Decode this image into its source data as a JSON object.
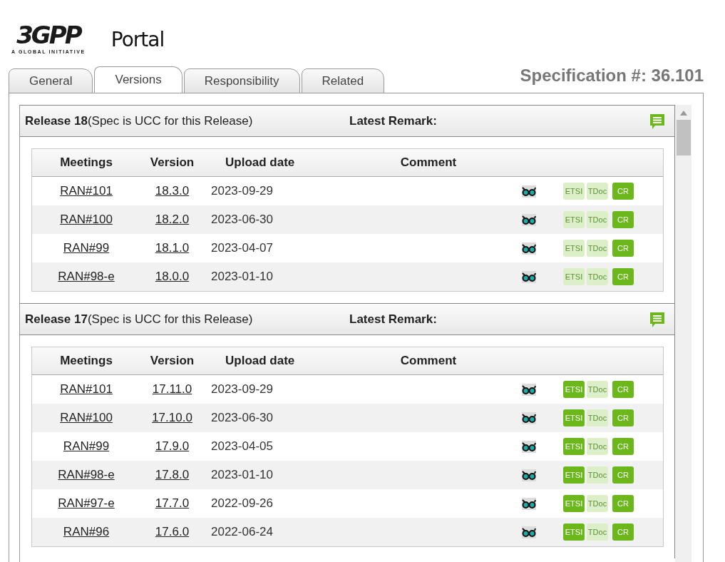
{
  "logo": {
    "mark": "3GPP",
    "tagline": "A GLOBAL INITIATIVE",
    "portal": "Portal"
  },
  "tabs": [
    {
      "label": "General",
      "selected": false
    },
    {
      "label": "Versions",
      "selected": true
    },
    {
      "label": "Responsibility",
      "selected": false
    },
    {
      "label": "Related",
      "selected": false
    }
  ],
  "spec_title": "Specification #: 36.101",
  "releases": [
    {
      "title": "**Release 18**(Spec is UCC for this Release)",
      "remark_label": "Latest Remark:",
      "columns": [
        "Meetings",
        "Version",
        "Upload date",
        "Comment"
      ],
      "rows": [
        {
          "meeting": "RAN#101",
          "version": "18.3.0",
          "date": "2023-09-29",
          "links": [
            {
              "label": "ETSI",
              "enabled": false
            },
            {
              "label": "TDoc",
              "enabled": false
            },
            {
              "label": "CR",
              "enabled": true
            }
          ]
        },
        {
          "meeting": "RAN#100",
          "version": "18.2.0",
          "date": "2023-06-30",
          "links": [
            {
              "label": "ETSI",
              "enabled": false
            },
            {
              "label": "TDoc",
              "enabled": false
            },
            {
              "label": "CR",
              "enabled": true
            }
          ]
        },
        {
          "meeting": "RAN#99",
          "version": "18.1.0",
          "date": "2023-04-07",
          "links": [
            {
              "label": "ETSI",
              "enabled": false
            },
            {
              "label": "TDoc",
              "enabled": false
            },
            {
              "label": "CR",
              "enabled": true
            }
          ]
        },
        {
          "meeting": "RAN#98-e",
          "version": "18.0.0",
          "date": "2023-01-10",
          "links": [
            {
              "label": "ETSI",
              "enabled": false
            },
            {
              "label": "TDoc",
              "enabled": false
            },
            {
              "label": "CR",
              "enabled": true
            }
          ]
        }
      ]
    },
    {
      "title": "**Release 17**(Spec is UCC for this Release)",
      "remark_label": "Latest Remark:",
      "columns": [
        "Meetings",
        "Version",
        "Upload date",
        "Comment"
      ],
      "rows": [
        {
          "meeting": "RAN#101",
          "version": "17.11.0",
          "date": "2023-09-29",
          "links": [
            {
              "label": "ETSI",
              "enabled": true
            },
            {
              "label": "TDoc",
              "enabled": false
            },
            {
              "label": "CR",
              "enabled": true
            }
          ]
        },
        {
          "meeting": "RAN#100",
          "version": "17.10.0",
          "date": "2023-06-30",
          "links": [
            {
              "label": "ETSI",
              "enabled": true
            },
            {
              "label": "TDoc",
              "enabled": false
            },
            {
              "label": "CR",
              "enabled": true
            }
          ]
        },
        {
          "meeting": "RAN#99",
          "version": "17.9.0",
          "date": "2023-04-05",
          "links": [
            {
              "label": "ETSI",
              "enabled": true
            },
            {
              "label": "TDoc",
              "enabled": false
            },
            {
              "label": "CR",
              "enabled": true
            }
          ]
        },
        {
          "meeting": "RAN#98-e",
          "version": "17.8.0",
          "date": "2023-01-10",
          "links": [
            {
              "label": "ETSI",
              "enabled": true
            },
            {
              "label": "TDoc",
              "enabled": false
            },
            {
              "label": "CR",
              "enabled": true
            }
          ]
        },
        {
          "meeting": "RAN#97-e",
          "version": "17.7.0",
          "date": "2022-09-26",
          "links": [
            {
              "label": "ETSI",
              "enabled": true
            },
            {
              "label": "TDoc",
              "enabled": false
            },
            {
              "label": "CR",
              "enabled": true
            }
          ]
        },
        {
          "meeting": "RAN#96",
          "version": "17.6.0",
          "date": "2022-06-24",
          "links": [
            {
              "label": "ETSI",
              "enabled": true
            },
            {
              "label": "TDoc",
              "enabled": false
            },
            {
              "label": "CR",
              "enabled": true
            }
          ]
        }
      ]
    }
  ]
}
